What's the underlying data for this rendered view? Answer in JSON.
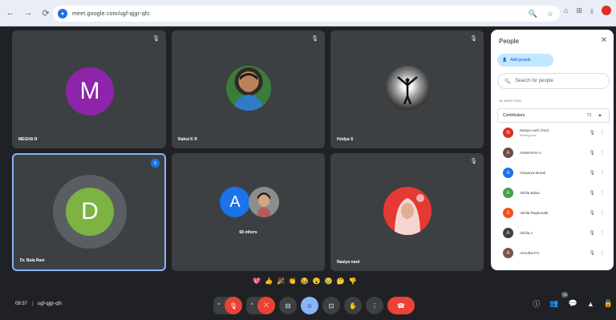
{
  "browser": {
    "url": "meet.google.com/ugf-qjgr-qfs",
    "nav": [
      "←",
      "→",
      "⟳"
    ],
    "right_icons": [
      "🔍",
      "☆",
      "⌂",
      "⋮"
    ]
  },
  "tiles": [
    {
      "name": "MEGHA R",
      "initial": "M",
      "color": "#8e24aa"
    },
    {
      "name": "Rahul K R",
      "photo": "man-portrait"
    },
    {
      "name": "Hridya S",
      "photo": "silhouette"
    },
    {
      "name": "Dr. Bala Ravi",
      "initial": "D",
      "color": "#7cb342"
    },
    {
      "name": "68 others",
      "initial": "A",
      "color": "#1a73e8"
    },
    {
      "name": "Nasiya nazii",
      "photo": "woman-hijab"
    }
  ],
  "people_panel": {
    "title": "People",
    "add_people": "Add people",
    "search_placeholder": "Search for people",
    "section_label": "IN MEETING",
    "contributors_label": "Contributors",
    "contributors_count": "73",
    "people": [
      {
        "name": "Nasiya nazii (You)",
        "sub": "Meeting host",
        "initial": "N",
        "color": "#d93025"
      },
      {
        "name": "AISWARYA A",
        "initial": "A",
        "color": "#6d4c41"
      },
      {
        "name": "Aiswarya Murali",
        "initial": "A",
        "color": "#1a73e8"
      },
      {
        "name": "Akhila Balan",
        "initial": "A",
        "color": "#43a047"
      },
      {
        "name": "Akhila Reghunath",
        "initial": "A",
        "color": "#f4511e"
      },
      {
        "name": "Akhila A",
        "initial": "A",
        "color": "#3c4043"
      },
      {
        "name": "Amrutha PV",
        "initial": "A",
        "color": "#795548"
      }
    ]
  },
  "reactions": [
    "💖",
    "👍",
    "🎉",
    "👏",
    "😂",
    "😮",
    "😢",
    "🤔",
    "👎"
  ],
  "meeting": {
    "time": "09:37",
    "code": "ugf-qjgr-qfs",
    "participants_badge": "73"
  }
}
